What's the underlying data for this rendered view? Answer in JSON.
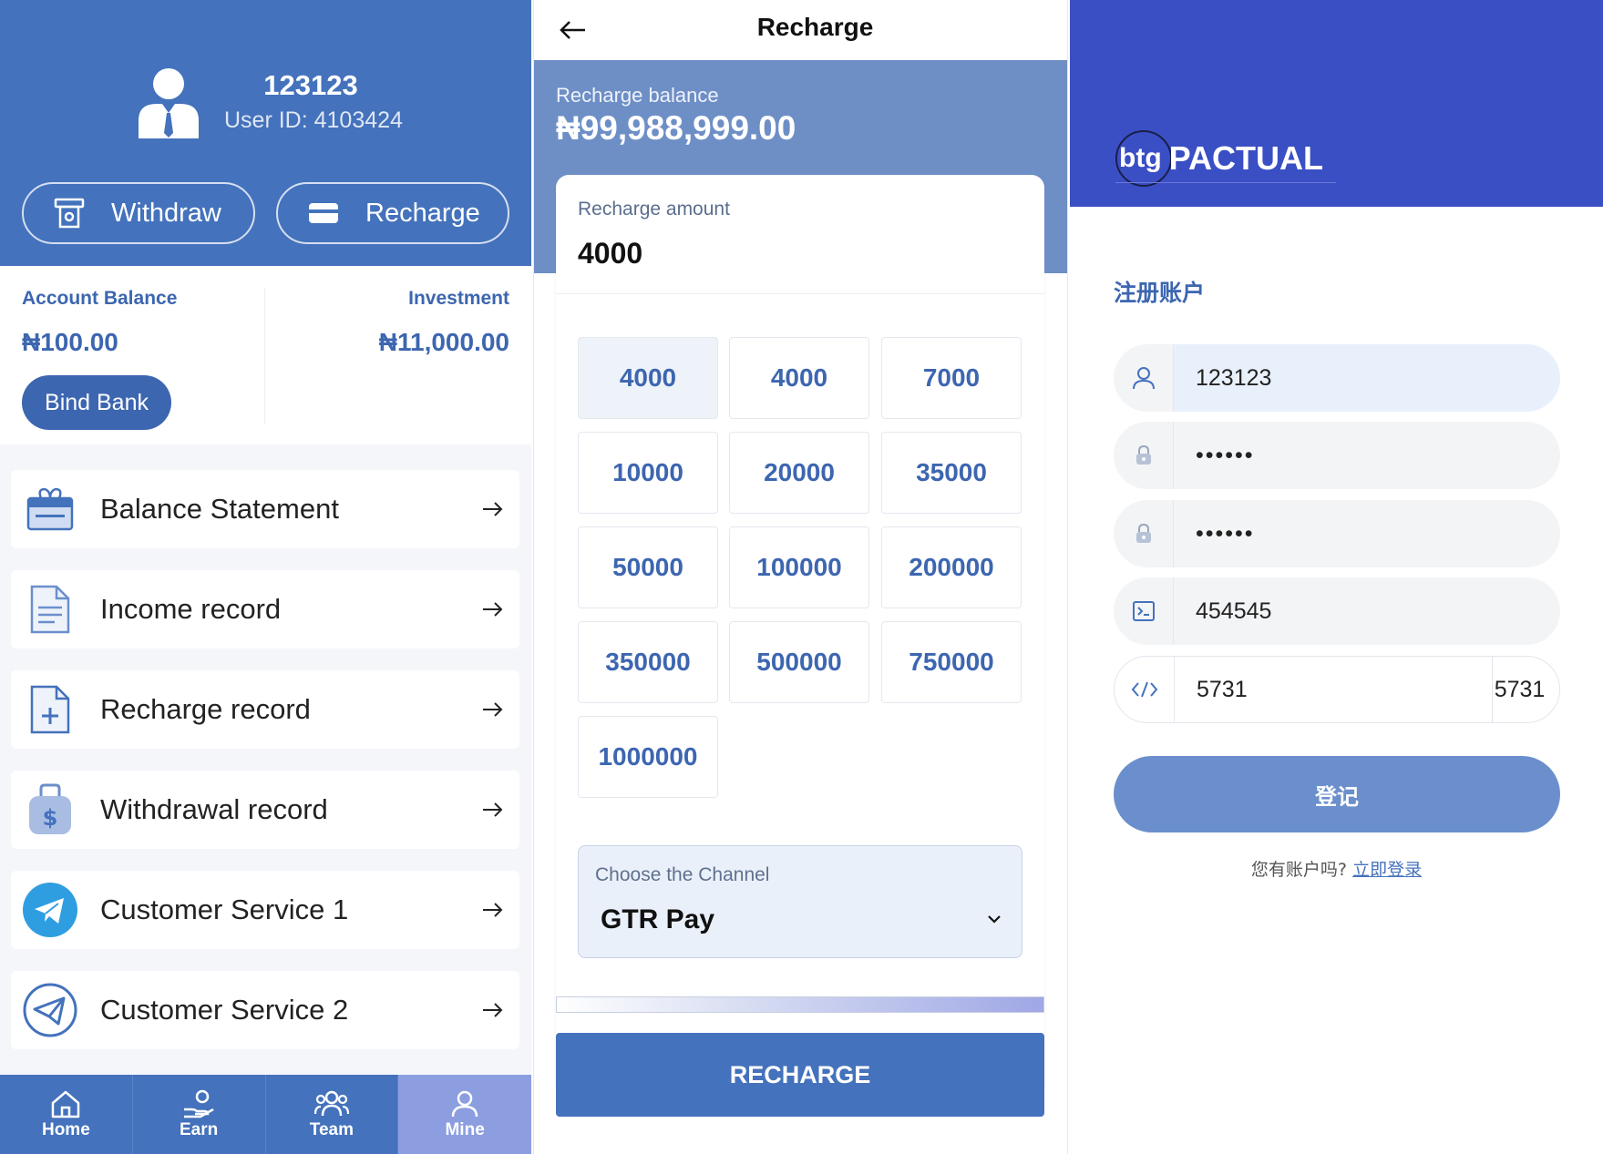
{
  "mine": {
    "username": "123123",
    "user_id": "User ID: 4103424",
    "withdraw_label": "Withdraw",
    "recharge_label": "Recharge",
    "account_balance_label": "Account Balance",
    "account_balance_value": "₦100.00",
    "investment_label": "Investment",
    "investment_value": "₦11,000.00",
    "bind_bank_label": "Bind Bank",
    "menu": [
      {
        "label": "Balance Statement",
        "icon": "gift-box-icon"
      },
      {
        "label": "Income record",
        "icon": "document-icon"
      },
      {
        "label": "Recharge record",
        "icon": "file-plus-icon"
      },
      {
        "label": "Withdrawal record",
        "icon": "money-bag-icon"
      },
      {
        "label": "Customer Service 1",
        "icon": "telegram-icon"
      },
      {
        "label": "Customer Service 2",
        "icon": "paper-plane-icon"
      }
    ],
    "tabs": [
      {
        "label": "Home",
        "icon": "home-icon"
      },
      {
        "label": "Earn",
        "icon": "hand-coins-icon"
      },
      {
        "label": "Team",
        "icon": "team-icon"
      },
      {
        "label": "Mine",
        "icon": "user-icon",
        "active": true
      }
    ]
  },
  "recharge": {
    "title": "Recharge",
    "balance_label": "Recharge balance",
    "balance_value": "₦99,988,999.00",
    "amount_label": "Recharge amount",
    "amount_value": "4000",
    "amounts": [
      "4000",
      "4000",
      "7000",
      "10000",
      "20000",
      "35000",
      "50000",
      "100000",
      "200000",
      "350000",
      "500000",
      "750000",
      "1000000"
    ],
    "selected_index": 0,
    "channel_label": "Choose the Channel",
    "channel_value": "GTR Pay",
    "button_label": "RECHARGE"
  },
  "register": {
    "logo_btg": "btg",
    "logo_text": "PACTUAL",
    "title": "注册账户",
    "username_value": "123123",
    "password_value": "••••••",
    "confirm_password_value": "••••••",
    "invite_code_value": "454545",
    "captcha_input_value": "5731",
    "captcha_code": "5731",
    "submit_label": "登记",
    "login_hint": "您有账户吗?",
    "login_link": "立即登录"
  },
  "colors": {
    "primary": "#4472bc",
    "hero": "#6e8fc6",
    "brand_header": "#3a4fc4",
    "tab_active": "#8c9ee0",
    "submit": "#6b8fcc"
  }
}
